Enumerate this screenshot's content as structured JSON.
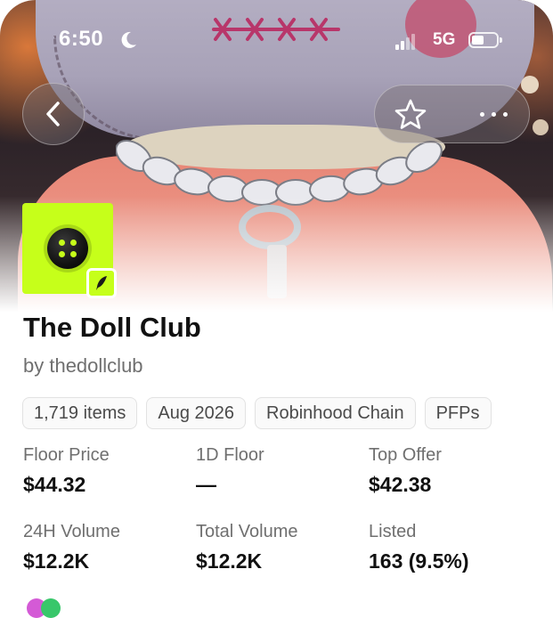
{
  "status_bar": {
    "time": "6:50",
    "network": "5G",
    "icons": [
      "moon-icon",
      "signal-icon",
      "battery-icon"
    ]
  },
  "nav": {
    "back_icon": "chevron-left-icon",
    "favorite_icon": "star-icon",
    "more_icon": "more-dots-icon"
  },
  "collection": {
    "name": "The Doll Club",
    "creator": "by thedollclub",
    "avatar_icon": "dice-logo",
    "verified_icon": "quill-badge-icon",
    "tags": [
      "1,719 items",
      "Aug 2026",
      "Robinhood Chain",
      "PFPs"
    ]
  },
  "stats": [
    {
      "label": "Floor Price",
      "value": "$44.32"
    },
    {
      "label": "1D Floor",
      "value": "—"
    },
    {
      "label": "Top Offer",
      "value": "$42.38"
    },
    {
      "label": "24H Volume",
      "value": "$12.2K"
    },
    {
      "label": "Total Volume",
      "value": "$12.2K"
    },
    {
      "label": "Listed",
      "value": "163 (9.5%)"
    }
  ],
  "colors": {
    "avatar_bg": "#c6ff1a",
    "text_primary": "#111111",
    "text_secondary": "#6f6f6f"
  }
}
